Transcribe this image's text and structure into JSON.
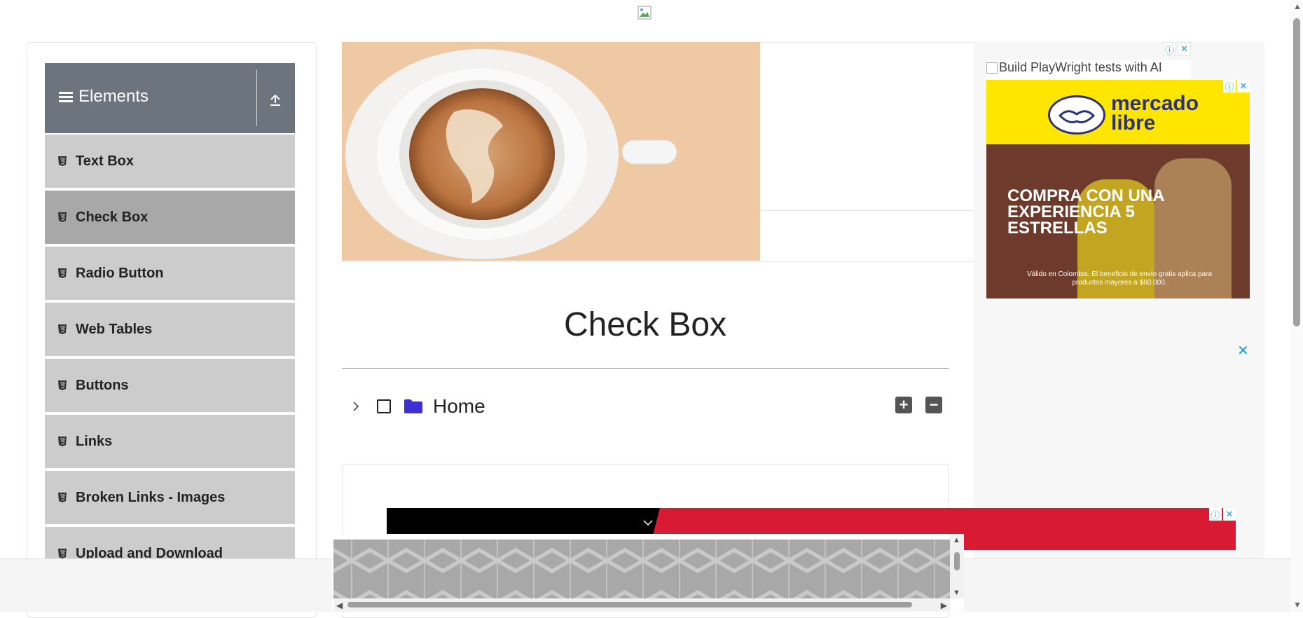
{
  "header": {
    "logo_icon": "broken-image-icon"
  },
  "sidebar": {
    "group_title": "Elements",
    "items": [
      {
        "label": "Text Box",
        "active": false
      },
      {
        "label": "Check Box",
        "active": true
      },
      {
        "label": "Radio Button",
        "active": false
      },
      {
        "label": "Web Tables",
        "active": false
      },
      {
        "label": "Buttons",
        "active": false
      },
      {
        "label": "Links",
        "active": false
      },
      {
        "label": "Broken Links - Images",
        "active": false
      },
      {
        "label": "Upload and Download",
        "active": false
      }
    ]
  },
  "main": {
    "title": "Check Box",
    "tree": {
      "root_label": "Home",
      "checked": false,
      "expanded": false
    },
    "expand_all_symbol": "+",
    "collapse_all_symbol": "−"
  },
  "ads": {
    "top_alt_text": "Build PlayWright tests with AI",
    "info_symbol": "ⓘ",
    "close_symbol": "✕",
    "mercado_logo": "mercado libre",
    "mercado_headline": "COMPRA CON UNA EXPERIENCIA 5 ESTRELLAS",
    "mercado_footnote": "Válido en Colombia. El beneficio de envío gratis aplica para productos mayores a $60.000."
  },
  "colors": {
    "sidebar_header": "#6c757d",
    "menu_item": "#cccccc",
    "menu_item_active": "#a8a8a8",
    "folder": "#3b30d4",
    "ad_accent": "#1b9bd8",
    "mercado_yellow": "#ffe600",
    "red_ad": "#d81b33"
  }
}
